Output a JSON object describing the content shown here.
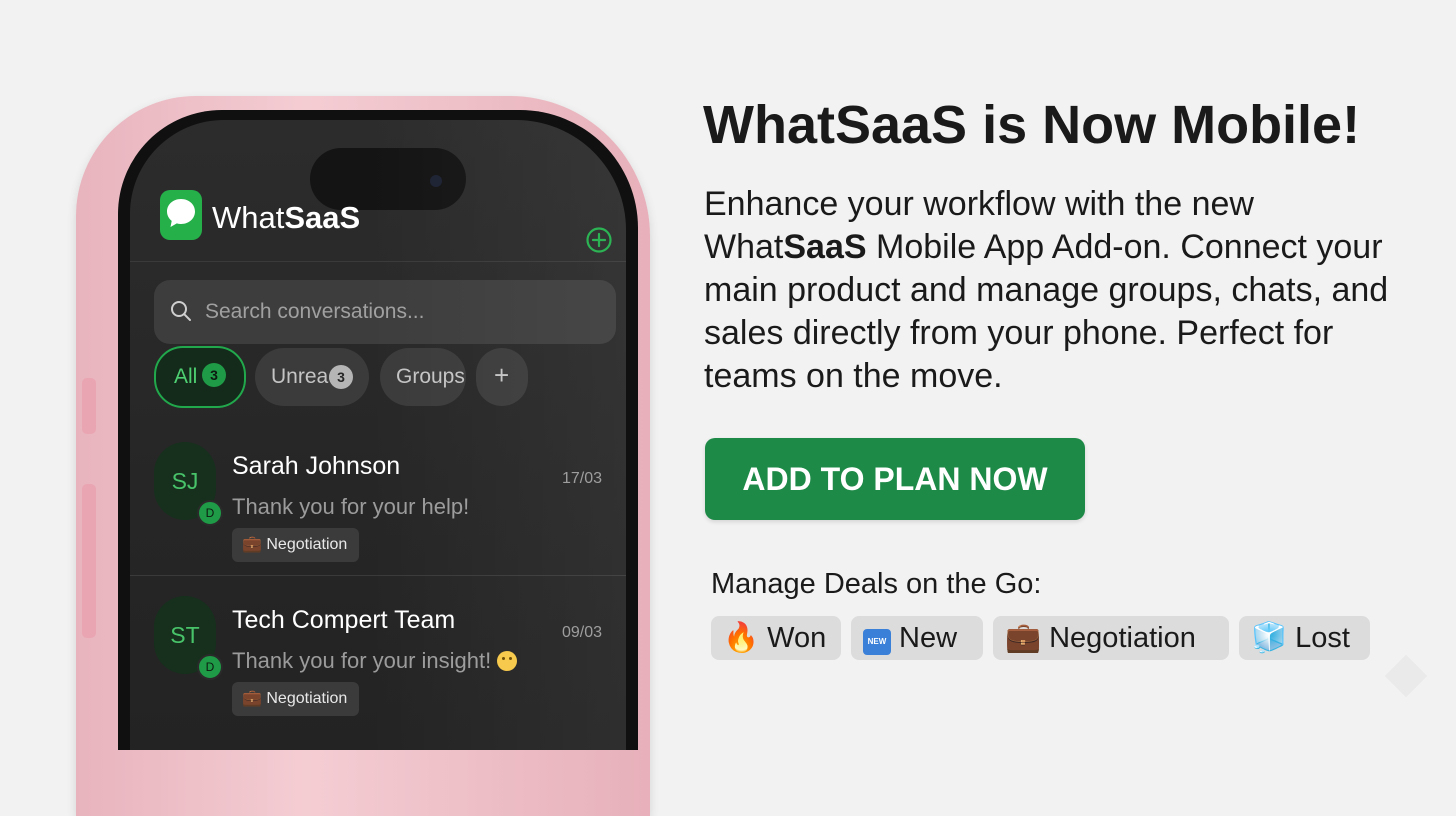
{
  "app": {
    "name_prefix": "What",
    "name_bold": "SaaS",
    "search_placeholder": "Search conversations...",
    "filters": [
      {
        "label": "All",
        "count": "3",
        "active": true
      },
      {
        "label": "Unread",
        "count": "3"
      },
      {
        "label": "Groups"
      },
      {
        "label": "+"
      }
    ],
    "conversations": [
      {
        "initials": "SJ",
        "badge": "D",
        "name": "Sarah Johnson",
        "message": "Thank you for your help!",
        "date": "17/03",
        "tag": "Negotiation"
      },
      {
        "initials": "ST",
        "badge": "D",
        "name": "Tech Compert Team",
        "message": "Thank you for your insight!",
        "date": "09/03",
        "tag": "Negotiation"
      }
    ]
  },
  "promo": {
    "headline": "WhatSaaS is Now Mobile!",
    "body": {
      "line1": "Enhance your workflow with the new",
      "line2_prefix": "What",
      "line2_bold": "SaaS",
      "line2_suffix": " Mobile App Add-on. Connect your",
      "line3": "main product and manage groups, chats, and",
      "line4": "sales directly from your phone. Perfect for",
      "line5": "teams on the move."
    },
    "cta_label": "ADD TO PLAN NOW",
    "deals_heading": "Manage Deals on the Go:",
    "deal_tags": [
      {
        "icon": "fire-icon",
        "glyph": "🔥",
        "label": "Won"
      },
      {
        "icon": "new-badge-icon",
        "glyph": "NEW",
        "label": "New"
      },
      {
        "icon": "briefcase-icon",
        "glyph": "💼",
        "label": "Negotiation"
      },
      {
        "icon": "ice-cube-icon",
        "glyph": "🧊",
        "label": "Lost"
      }
    ]
  },
  "colors": {
    "brand_green": "#25b04a",
    "cta_green": "#1e8a48",
    "phone_pink": "#f0c3cb",
    "screen_dark": "#262626"
  }
}
